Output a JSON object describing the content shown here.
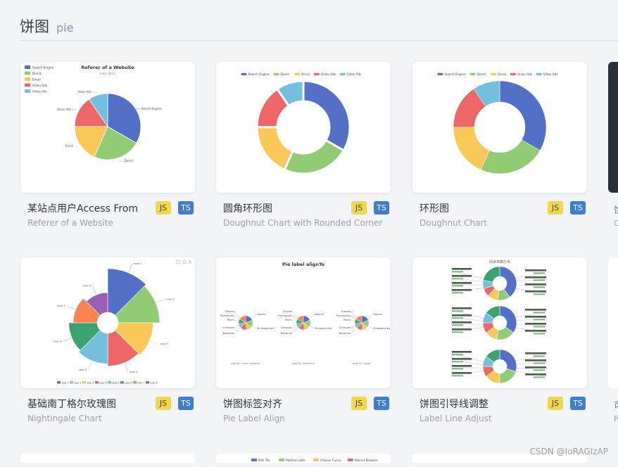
{
  "header": {
    "title_zh": "饼图",
    "title_en": "pie"
  },
  "cards": [
    {
      "title": "某站点用户Access From",
      "subtitle": "Referer of a Website"
    },
    {
      "title": "圆角环形图",
      "subtitle": "Doughnut Chart with Rounded Corner"
    },
    {
      "title": "环形图",
      "subtitle": "Doughnut Chart"
    },
    {
      "title": "基础南丁格尔玫瑰图",
      "subtitle": "Nightingale Chart"
    },
    {
      "title": "饼图标签对齐",
      "subtitle": "Pie Label Align"
    },
    {
      "title": "饼图引导线调整",
      "subtitle": "Label Line Adjust"
    }
  ],
  "badges": {
    "js": "JS",
    "ts": "TS"
  },
  "palette": [
    "#5470c6",
    "#91cc75",
    "#fac858",
    "#ee6666",
    "#73c0de",
    "#3ba272",
    "#fc8452",
    "#9a60b4"
  ],
  "thumb1": {
    "title": "Referer of a Website",
    "subtitle": "Fake Data",
    "legend": [
      "Search Engine",
      "Direct",
      "Email",
      "Union Ads",
      "Video Ads"
    ],
    "values": [
      1048,
      735,
      580,
      484,
      300
    ]
  },
  "thumb2": {
    "legend": [
      "Search Engine",
      "Direct",
      "Email",
      "Union Ads",
      "Video Ads"
    ],
    "values": [
      1048,
      735,
      580,
      484,
      300
    ]
  },
  "thumb3": {
    "legend": [
      "Search Engine",
      "Direct",
      "Email",
      "Union Ads",
      "Video Ads"
    ],
    "values": [
      1048,
      735,
      580,
      484,
      300
    ]
  },
  "thumb4": {
    "labels": [
      "rose 1",
      "rose 2",
      "rose 3",
      "rose 4",
      "rose 5",
      "rose 6",
      "rose 7",
      "rose 8"
    ],
    "values": [
      40,
      38,
      32,
      30,
      28,
      26,
      22,
      18
    ]
  },
  "thumb5": {
    "title": "Pie label alignTo",
    "captions": [
      "alignTo: 'none' (default)",
      "alignTo: 'labelLine'",
      "alignTo: 'edge'"
    ],
    "fruit_labels": [
      "Apples",
      "Grapes",
      "Pineapples",
      "Pears",
      "Oranges",
      "Bananas",
      "Strawberries"
    ]
  },
  "thumb6": {
    "title": "阅读书籍分布"
  },
  "bottom_legend": [
    "Milk Tea",
    "Matcha Latte",
    "Cheese Cocoa",
    "Walnut Brownie"
  ],
  "edge_texts": [
    "饼",
    "C",
    "可",
    "P"
  ],
  "watermark": "CSDN @IoRAGIzAP"
}
